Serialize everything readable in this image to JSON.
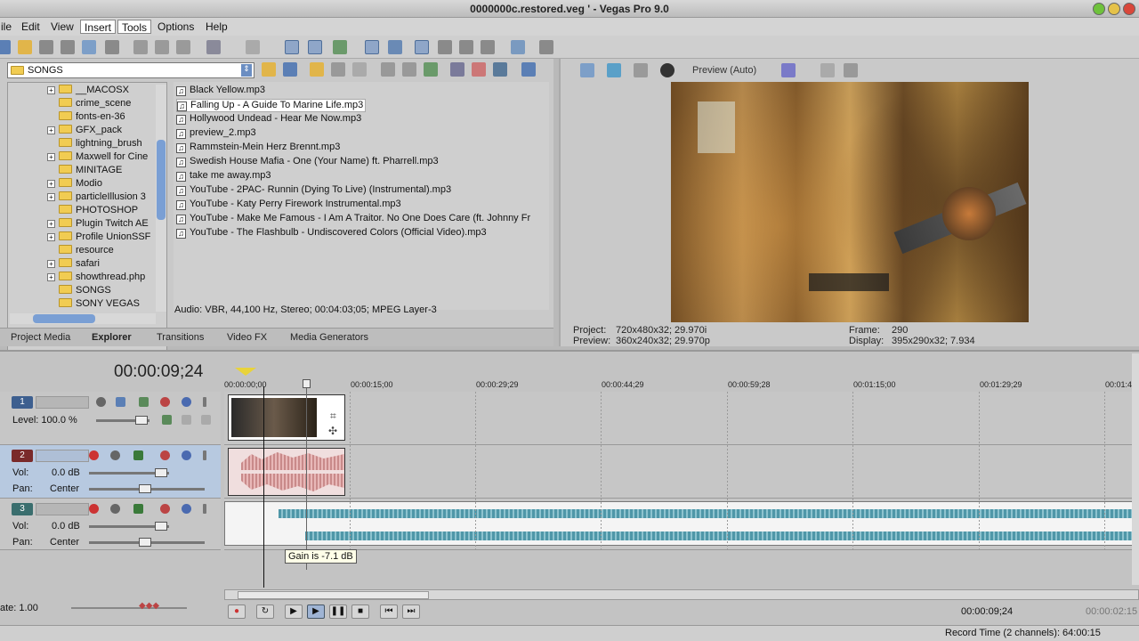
{
  "window": {
    "title": "0000000c.restored.veg ' - Vegas Pro 9.0"
  },
  "menu": {
    "items": [
      "ile",
      "Edit",
      "View",
      "Insert",
      "Tools",
      "Options",
      "Help"
    ]
  },
  "explorer": {
    "path": "SONGS",
    "tree": [
      "__MACOSX",
      "crime_scene",
      "fonts-en-36",
      "GFX_pack",
      "lightning_brush",
      "Maxwell for Cine",
      "MINITAGE",
      "Modio",
      "particleIllusion 3",
      "PHOTOSHOP",
      "Plugin Twitch AE",
      "Profile UnionSSF",
      "resource",
      "safari",
      "showthread.php",
      "SONGS",
      "SONY VEGAS"
    ],
    "files": [
      "Black Yellow.mp3",
      "Falling Up - A Guide To Marine Life.mp3",
      "Hollywood Undead - Hear Me Now.mp3",
      "preview_2.mp3",
      "Rammstein-Mein Herz Brennt.mp3",
      "Swedish House Mafia - One (Your Name) ft. Pharrell.mp3",
      "take me away.mp3",
      "YouTube - 2PAC- Runnin (Dying To Live) (Instrumental).mp3",
      "YouTube - Katy Perry Firework Instrumental.mp3",
      "YouTube - Make Me Famous - I Am A Traitor. No One Does Care (ft. Johnny Fr",
      "YouTube - The Flashbulb - Undiscovered Colors (Official Video).mp3"
    ],
    "info": "Audio: VBR, 44,100 Hz, Stereo; 00:04:03;05; MPEG Layer-3",
    "tabs": [
      "Project Media",
      "Explorer",
      "Transitions",
      "Video FX",
      "Media Generators"
    ]
  },
  "preview": {
    "mode": "Preview (Auto)",
    "project_label": "Project:",
    "project_value": "720x480x32; 29.970i",
    "preview_label": "Preview:",
    "preview_value": "360x240x32; 29.970p",
    "frame_label": "Frame:",
    "frame_value": "290",
    "display_label": "Display:",
    "display_value": "395x290x32; 7.934"
  },
  "timeline": {
    "timecode": "00:00:09;24",
    "ruler": [
      "00:00:00;00",
      "00:00:15;00",
      "00:00:29;29",
      "00:00:44;29",
      "00:00:59;28",
      "00:01:15;00",
      "00:01:29;29",
      "00:01:4"
    ],
    "tracks": [
      {
        "num": "1",
        "label1": "Level: 100.0 %"
      },
      {
        "num": "2",
        "vol_label": "Vol:",
        "vol": "0.0 dB",
        "pan_label": "Pan:",
        "pan": "Center"
      },
      {
        "num": "3",
        "vol_label": "Vol:",
        "vol": "0.0 dB",
        "pan_label": "Pan:",
        "pan": "Center"
      }
    ],
    "tooltip": "Gain is -7.1 dB",
    "rate": "ate: 1.00",
    "transport_time": "00:00:09;24",
    "transport_time2": "00:00:02:15"
  },
  "status": {
    "record_time": "Record Time (2 channels): 64:00:15"
  },
  "colors": {
    "track1": "#3d5f8f",
    "track2": "#7a2a2a",
    "track3": "#3a6e6e",
    "waveform": "#4f97a8",
    "audio_clip": "#d89a9a"
  }
}
